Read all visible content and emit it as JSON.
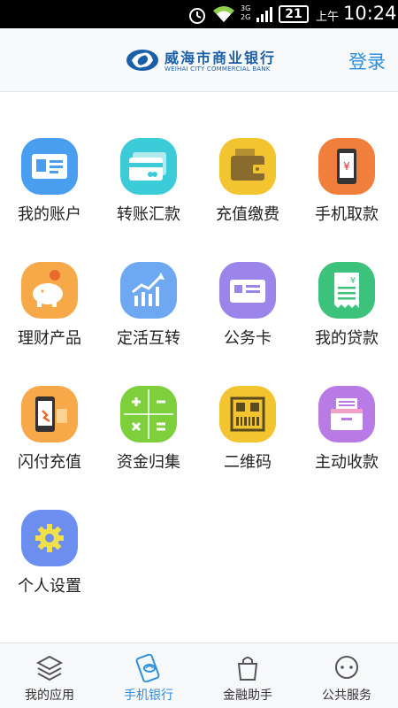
{
  "status_bar": {
    "network": "3G\n2G",
    "battery": "21",
    "ampm": "上午",
    "time": "10:24"
  },
  "header": {
    "brand_cn": "威海市商业银行",
    "brand_en": "WEIHAI CITY COMMERCIAL BANK",
    "login": "登录",
    "brand_color": "#1b5fa8",
    "accent_color": "#2a8fe0"
  },
  "grid": [
    {
      "label": "我的账户",
      "icon": "id-card-icon",
      "color": "#4a9ef0"
    },
    {
      "label": "转账汇款",
      "icon": "bank-card-icon",
      "color": "#3ccbd8"
    },
    {
      "label": "充值缴费",
      "icon": "wallet-icon",
      "color": "#f2c530"
    },
    {
      "label": "手机取款",
      "icon": "phone-yuan-icon",
      "color": "#f07f3c"
    },
    {
      "label": "理财产品",
      "icon": "piggy-bank-icon",
      "color": "#f7a94a"
    },
    {
      "label": "定活互转",
      "icon": "trend-chart-icon",
      "color": "#6ea8f2"
    },
    {
      "label": "公务卡",
      "icon": "card-icon",
      "color": "#9b84ea"
    },
    {
      "label": "我的贷款",
      "icon": "receipt-icon",
      "color": "#3cc27a"
    },
    {
      "label": "闪付充值",
      "icon": "phone-pay-icon",
      "color": "#f7a94a"
    },
    {
      "label": "资金归集",
      "icon": "calculator-icon",
      "color": "#7dcf3c"
    },
    {
      "label": "二维码",
      "icon": "qr-code-icon",
      "color": "#f2c530"
    },
    {
      "label": "主动收款",
      "icon": "inbox-tray-icon",
      "color": "#b87be6"
    },
    {
      "label": "个人设置",
      "icon": "gear-icon",
      "color": "#6b8ef0"
    }
  ],
  "bottom_nav": [
    {
      "label": "我的应用",
      "icon": "layers-icon",
      "active": false
    },
    {
      "label": "手机银行",
      "icon": "mobile-bank-icon",
      "active": true
    },
    {
      "label": "金融助手",
      "icon": "shopping-bag-icon",
      "active": false
    },
    {
      "label": "公共服务",
      "icon": "chat-bubble-icon",
      "active": false
    }
  ]
}
